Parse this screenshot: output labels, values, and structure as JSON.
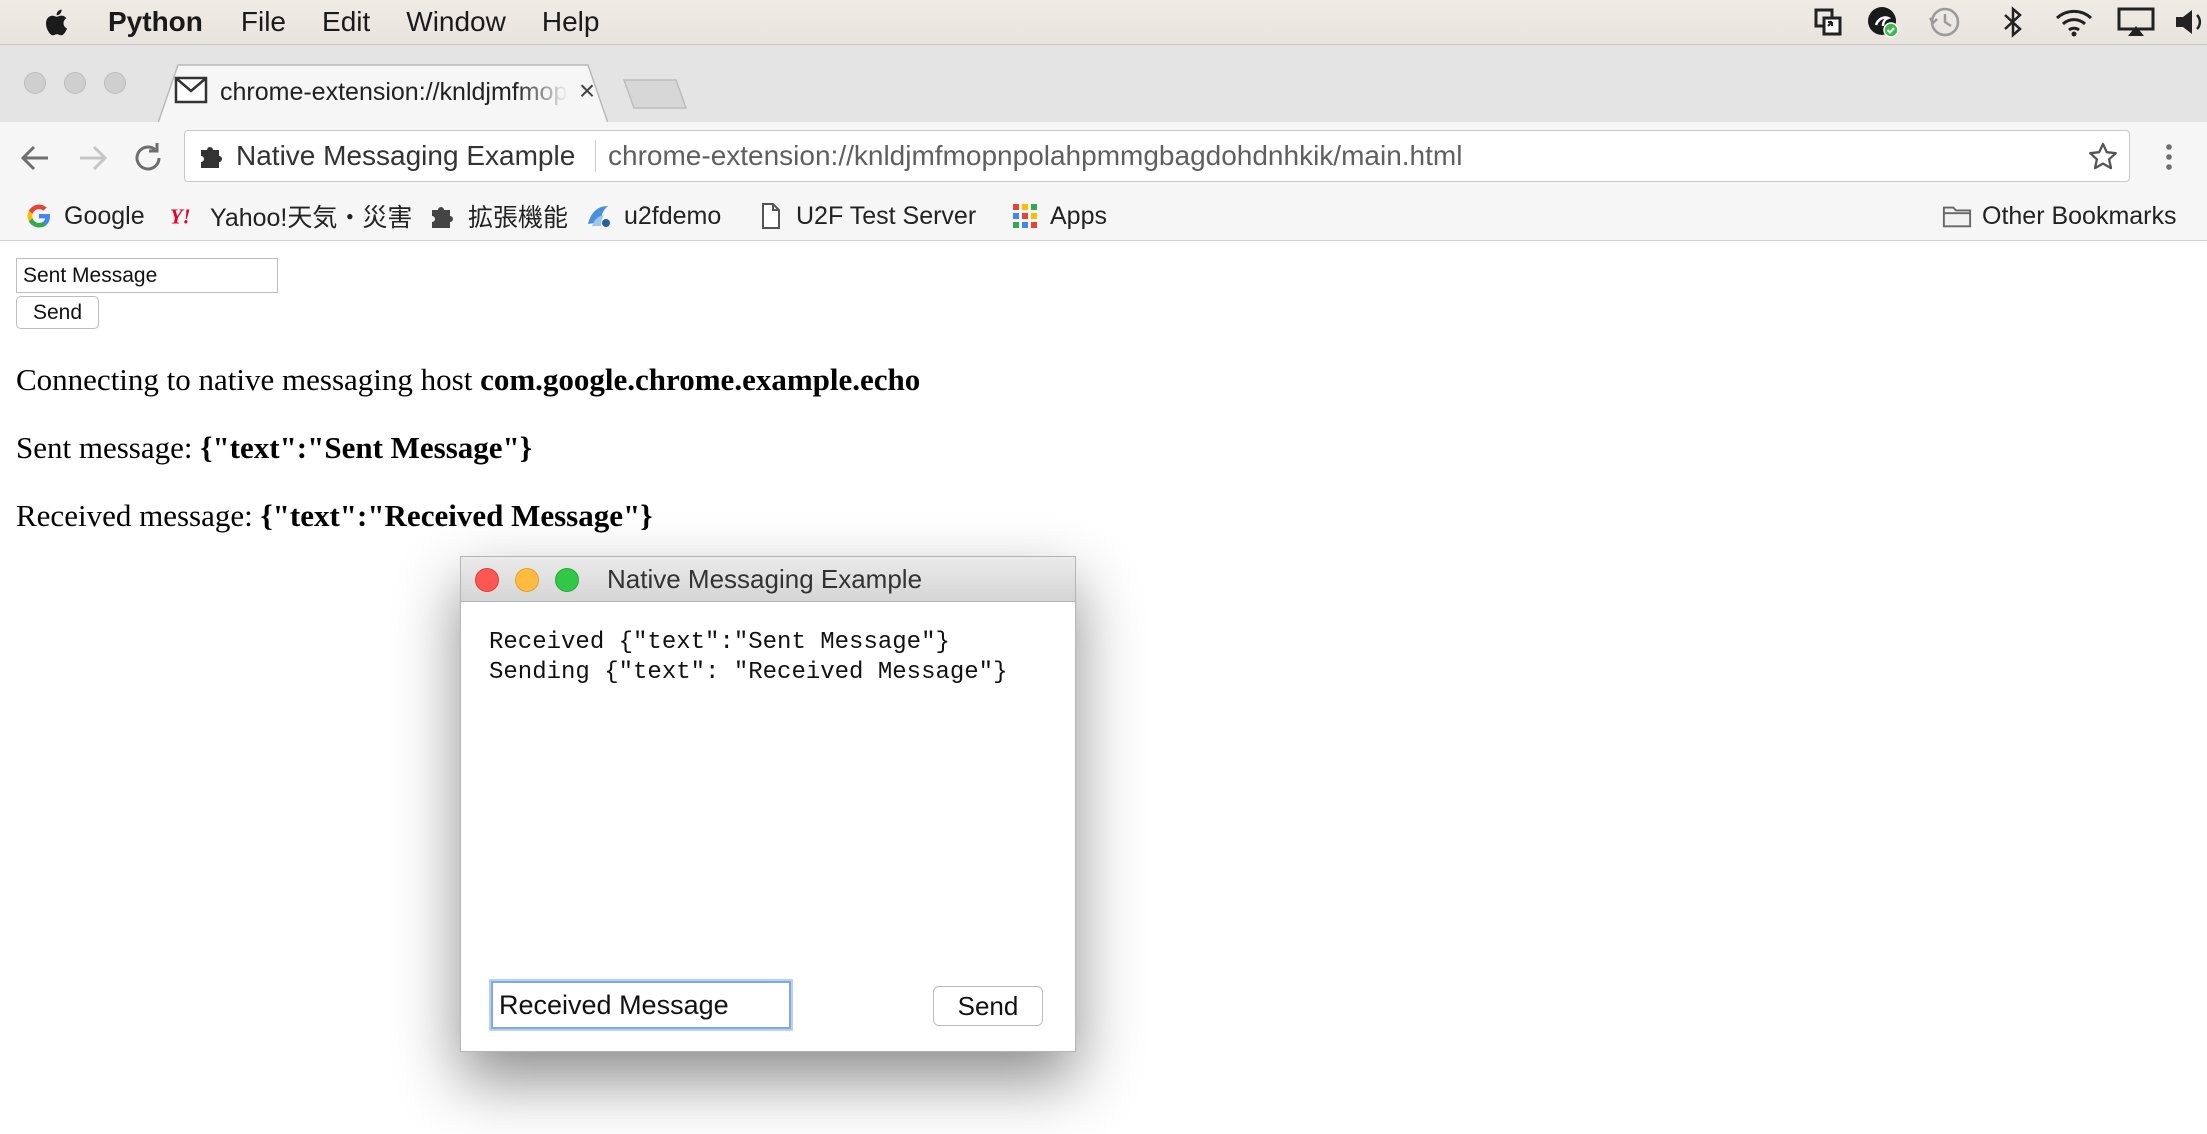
{
  "menubar": {
    "app_name": "Python",
    "items": [
      "File",
      "Edit",
      "Window",
      "Help"
    ],
    "status_icons": [
      "window-switch-icon",
      "account-sync-icon",
      "time-machine-icon",
      "bluetooth-icon",
      "wifi-icon",
      "airplay-icon",
      "volume-icon"
    ]
  },
  "browser": {
    "tab": {
      "title": "chrome-extension://knldjmfmopnpolahpmmgbagdohdnhkik/main.html",
      "close": "×",
      "favicon": "gmail-envelope-icon"
    },
    "omnibox": {
      "site_name": "Native Messaging Example",
      "url": "chrome-extension://knldjmfmopnpolahpmmgbagdohdnhkik/main.html"
    },
    "bookmarks": [
      {
        "label": "Google",
        "icon": "google-icon"
      },
      {
        "label": "Yahoo!天気・災害",
        "icon": "yahoo-icon"
      },
      {
        "label": "拡張機能",
        "icon": "extension-puzzle-icon"
      },
      {
        "label": "u2fdemo",
        "icon": "u2f-icon"
      },
      {
        "label": "U2F Test Server",
        "icon": "page-icon"
      },
      {
        "label": "Apps",
        "icon": "apps-grid-icon"
      }
    ],
    "other_bookmarks": "Other Bookmarks"
  },
  "page": {
    "input_value": "Sent Message",
    "send_button": "Send",
    "lines": [
      {
        "prefix": "Connecting to native messaging host ",
        "bold": "com.google.chrome.example.echo"
      },
      {
        "prefix": "Sent message: ",
        "bold": "{\"text\":\"Sent Message\"}"
      },
      {
        "prefix": "Received message: ",
        "bold": "{\"text\":\"Received Message\"}"
      }
    ]
  },
  "dialog": {
    "title": "Native Messaging Example",
    "log": [
      "Received {\"text\":\"Sent Message\"}",
      "Sending {\"text\": \"Received Message\"}"
    ],
    "input_value": "Received Message",
    "send_button": "Send"
  },
  "colors": {
    "menubar_bg": "#ede7e2",
    "tab_strip_bg": "#e4e4e4",
    "toolbar_bg": "#f6f6f6",
    "traffic_red": "#fc5753",
    "traffic_yellow": "#fdbc40",
    "traffic_green": "#33c748",
    "focus_ring": "#7fa9e0"
  }
}
